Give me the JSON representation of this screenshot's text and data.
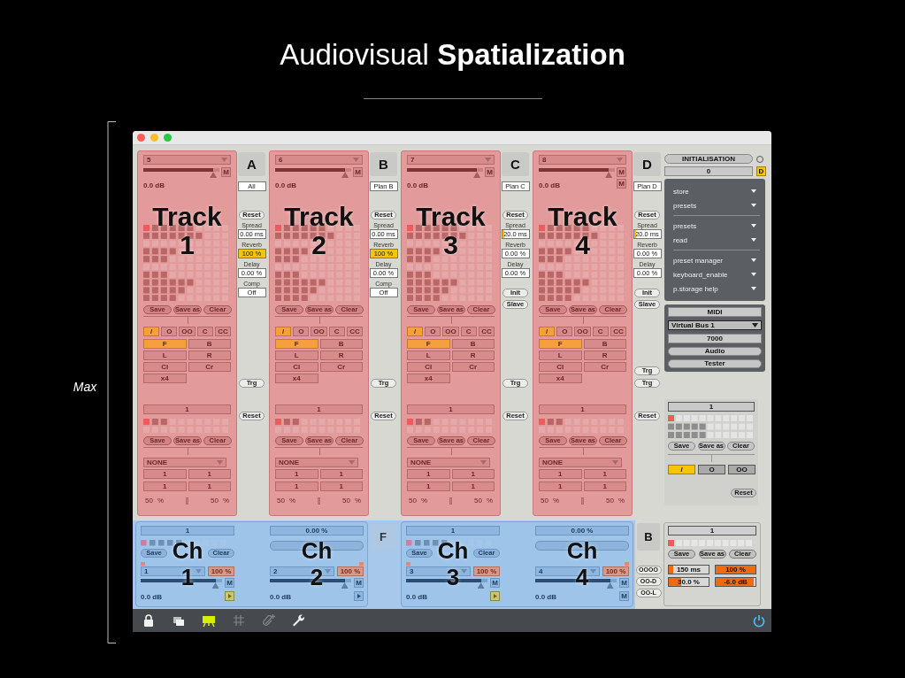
{
  "slide": {
    "title": "Audiovisual **Spatialization**",
    "side_label": "Max"
  },
  "window": {
    "tracks": [
      {
        "preset": "5",
        "level": 0.92,
        "mutes": [
          "M"
        ],
        "reading": "0.0 dB",
        "label": "Track",
        "number": "1",
        "pads": [
          "Save",
          "Save as",
          "Clear"
        ],
        "modes": [
          {
            "label": "/",
            "selected": true
          },
          {
            "label": "O",
            "selected": false
          },
          {
            "label": "OO",
            "selected": false
          },
          {
            "label": "C",
            "selected": false
          },
          {
            "label": "CC",
            "selected": false
          }
        ],
        "speakers": [
          {
            "label": "F",
            "selected": true
          },
          {
            "label": "B",
            "selected": false
          },
          {
            "label": "L",
            "selected": false
          },
          {
            "label": "R",
            "selected": false
          },
          {
            "label": "Cl",
            "selected": false
          },
          {
            "label": "Cr",
            "selected": false
          },
          {
            "label": "x4",
            "selected": false
          }
        ],
        "group": "1",
        "group_buttons": [
          "Save",
          "Save as",
          "Clear"
        ],
        "source": "NONE",
        "routes": [
          "1",
          "1",
          "1",
          "1"
        ],
        "footer": [
          "50",
          "%",
          "50",
          "%"
        ]
      },
      {
        "preset": "6",
        "level": 0.92,
        "mutes": [
          "M"
        ],
        "reading": "0.0 dB",
        "label": "Track",
        "number": "2",
        "pads": [
          "Save",
          "Save as",
          "Clear"
        ],
        "modes": [
          {
            "label": "/",
            "selected": true
          },
          {
            "label": "O",
            "selected": false
          },
          {
            "label": "OO",
            "selected": false
          },
          {
            "label": "C",
            "selected": false
          },
          {
            "label": "CC",
            "selected": false
          }
        ],
        "speakers": [
          {
            "label": "F",
            "selected": true
          },
          {
            "label": "B",
            "selected": false
          },
          {
            "label": "L",
            "selected": false
          },
          {
            "label": "R",
            "selected": false
          },
          {
            "label": "Cl",
            "selected": false
          },
          {
            "label": "Cr",
            "selected": false
          },
          {
            "label": "x4",
            "selected": false
          }
        ],
        "group": "1",
        "group_buttons": [
          "Save",
          "Save as",
          "Clear"
        ],
        "source": "NONE",
        "routes": [
          "1",
          "1",
          "1",
          "1"
        ],
        "footer": [
          "50",
          "%",
          "50",
          "%"
        ]
      },
      {
        "preset": "7",
        "level": 0.92,
        "mutes": [
          "M"
        ],
        "reading": "0.0 dB",
        "label": "Track",
        "number": "3",
        "pads": [
          "Save",
          "Save as",
          "Clear"
        ],
        "modes": [
          {
            "label": "/",
            "selected": true
          },
          {
            "label": "O",
            "selected": false
          },
          {
            "label": "OO",
            "selected": false
          },
          {
            "label": "C",
            "selected": false
          },
          {
            "label": "CC",
            "selected": false
          }
        ],
        "speakers": [
          {
            "label": "F",
            "selected": true
          },
          {
            "label": "B",
            "selected": false
          },
          {
            "label": "L",
            "selected": false
          },
          {
            "label": "R",
            "selected": false
          },
          {
            "label": "Cl",
            "selected": false
          },
          {
            "label": "Cr",
            "selected": false
          },
          {
            "label": "x4",
            "selected": false
          }
        ],
        "group": "1",
        "group_buttons": [
          "Save",
          "Save as",
          "Clear"
        ],
        "source": "NONE",
        "routes": [
          "1",
          "1",
          "1",
          "1"
        ],
        "footer": [
          "50",
          "%",
          "50",
          "%"
        ]
      },
      {
        "preset": "8",
        "level": 0.92,
        "mutes": [
          "M",
          "M"
        ],
        "reading": "0.0 dB",
        "label": "Track",
        "number": "4",
        "pads": [
          "Save",
          "Save as",
          "Clear"
        ],
        "modes": [
          {
            "label": "/",
            "selected": true
          },
          {
            "label": "O",
            "selected": false
          },
          {
            "label": "OO",
            "selected": false
          },
          {
            "label": "C",
            "selected": false
          },
          {
            "label": "CC",
            "selected": false
          }
        ],
        "speakers": [
          {
            "label": "F",
            "selected": true
          },
          {
            "label": "B",
            "selected": false
          },
          {
            "label": "L",
            "selected": false
          },
          {
            "label": "R",
            "selected": false
          },
          {
            "label": "Cl",
            "selected": false
          },
          {
            "label": "Cr",
            "selected": false
          },
          {
            "label": "x4",
            "selected": false
          }
        ],
        "group": "1",
        "group_buttons": [
          "Save",
          "Save as",
          "Clear"
        ],
        "source": "NONE",
        "routes": [
          "1",
          "1",
          "1",
          "1"
        ],
        "footer": [
          "50",
          "%",
          "50",
          "%"
        ]
      }
    ],
    "track_controls": [
      {
        "letter": "A",
        "plan": "All",
        "reset": "Reset",
        "params": [
          {
            "label": "Spread",
            "value": "0.00 ms",
            "level": 0
          },
          {
            "label": "Reverb",
            "value": "100 %",
            "level": 1
          },
          {
            "label": "Delay",
            "value": "0.00 %",
            "level": 0
          },
          {
            "label": "Comp",
            "value": "Off",
            "level": 0
          }
        ],
        "triggers": [
          "Trg"
        ],
        "reset_lower": "Reset"
      },
      {
        "letter": "B",
        "plan": "Plan B",
        "reset": "Reset",
        "params": [
          {
            "label": "Spread",
            "value": "0.00 ms",
            "level": 0
          },
          {
            "label": "Reverb",
            "value": "100 %",
            "level": 1
          },
          {
            "label": "Delay",
            "value": "0.00 %",
            "level": 0
          },
          {
            "label": "Comp",
            "value": "Off",
            "level": 0
          }
        ],
        "triggers": [
          "Trg"
        ],
        "reset_lower": "Reset"
      },
      {
        "letter": "C",
        "plan": "Plan C",
        "reset": "Reset",
        "params": [
          {
            "label": "Spread",
            "value": "20.0 ms",
            "level": 0.08
          },
          {
            "label": "Reverb",
            "value": "0.00 %",
            "level": 0
          },
          {
            "label": "Delay",
            "value": "0.00 %",
            "level": 0
          }
        ],
        "buttons": [
          "Init",
          "Slave"
        ],
        "triggers": [
          "Trg"
        ],
        "reset_lower": "Reset"
      },
      {
        "letter": "D",
        "plan": "Plan D",
        "reset": "Reset",
        "params": [
          {
            "label": "Spread",
            "value": "20.0 ms",
            "level": 0.08
          },
          {
            "label": "Reverb",
            "value": "0.00 %",
            "level": 0
          },
          {
            "label": "Delay",
            "value": "0.00 %",
            "level": 0
          }
        ],
        "buttons": [
          "Init",
          "Slave"
        ],
        "triggers": [
          "Trg",
          "Trg"
        ],
        "reset_lower": "Reset"
      }
    ],
    "right_panel": {
      "init": "INITIALISATION",
      "init_led": false,
      "init_value": "0",
      "d": "D",
      "menus": [
        [
          "store",
          "presets"
        ],
        [
          "presets",
          "read"
        ],
        [
          "preset manager",
          "keyboard_enable",
          "p.storage help"
        ]
      ],
      "midi": {
        "title": "MIDI",
        "device": "Virtual Bus 1",
        "port": "7000",
        "buttons": [
          "Audio",
          "Tester"
        ]
      },
      "spat": {
        "value": "1",
        "buttons": [
          "Save",
          "Save as",
          "Clear"
        ],
        "modes": [
          {
            "label": "/",
            "selected": true
          },
          {
            "label": "O",
            "selected": false
          },
          {
            "label": "OO",
            "selected": false
          }
        ],
        "reset": "Reset"
      }
    },
    "channels": [
      {
        "kind": "preset",
        "value": "1",
        "buttons": [
          "Save",
          "Clear"
        ],
        "label": "Ch",
        "number": "1",
        "source": "1",
        "gain": "100 %",
        "level": 0.92,
        "mutes": [
          "M"
        ],
        "play_on": true,
        "reading": "0.0 dB"
      },
      {
        "kind": "reverb",
        "value": "0.00 %",
        "label": "Ch",
        "number": "2",
        "source": "2",
        "gain": "100 %",
        "level": 0.92,
        "mutes": [
          "M"
        ],
        "play_on": false,
        "reading": "0.0 dB"
      },
      {
        "kind": "preset",
        "value": "1",
        "buttons": [
          "Save",
          "Clear"
        ],
        "label": "Ch",
        "number": "3",
        "source": "3",
        "gain": "100 %",
        "level": 0.92,
        "mutes": [
          "M"
        ],
        "play_on": true,
        "reading": "0.0 dB"
      },
      {
        "kind": "reverb",
        "value": "0.00 %",
        "label": "Ch",
        "number": "4",
        "source": "4",
        "gain": "100 %",
        "level": 0.92,
        "mutes": [
          "M",
          "M"
        ],
        "reading": "0.0 dB"
      }
    ],
    "buses": [
      "F",
      "B"
    ],
    "bus_buttons": [
      "OOOO",
      "OO-D",
      "OO-L"
    ],
    "output": {
      "value": "1",
      "buttons": [
        "Save",
        "Save as",
        "Clear"
      ],
      "params": [
        {
          "value": "150 ms",
          "level": 0.12
        },
        {
          "value": "100 %",
          "level": 1
        },
        {
          "value": "30.0 %",
          "level": 0.3
        },
        {
          "value": "-6.0 dB",
          "level": 0.96
        }
      ]
    },
    "toolbar": {
      "tools": [
        {
          "kind": "lock",
          "selected": false,
          "disabled": false
        },
        {
          "kind": "windows",
          "selected": false,
          "disabled": false
        },
        {
          "kind": "presentation",
          "selected": true,
          "disabled": false
        },
        {
          "kind": "grid",
          "selected": false,
          "disabled": true
        },
        {
          "kind": "clip",
          "selected": false,
          "disabled": true
        },
        {
          "kind": "wrench",
          "selected": false,
          "disabled": false
        }
      ],
      "power": {
        "on": true
      }
    }
  }
}
